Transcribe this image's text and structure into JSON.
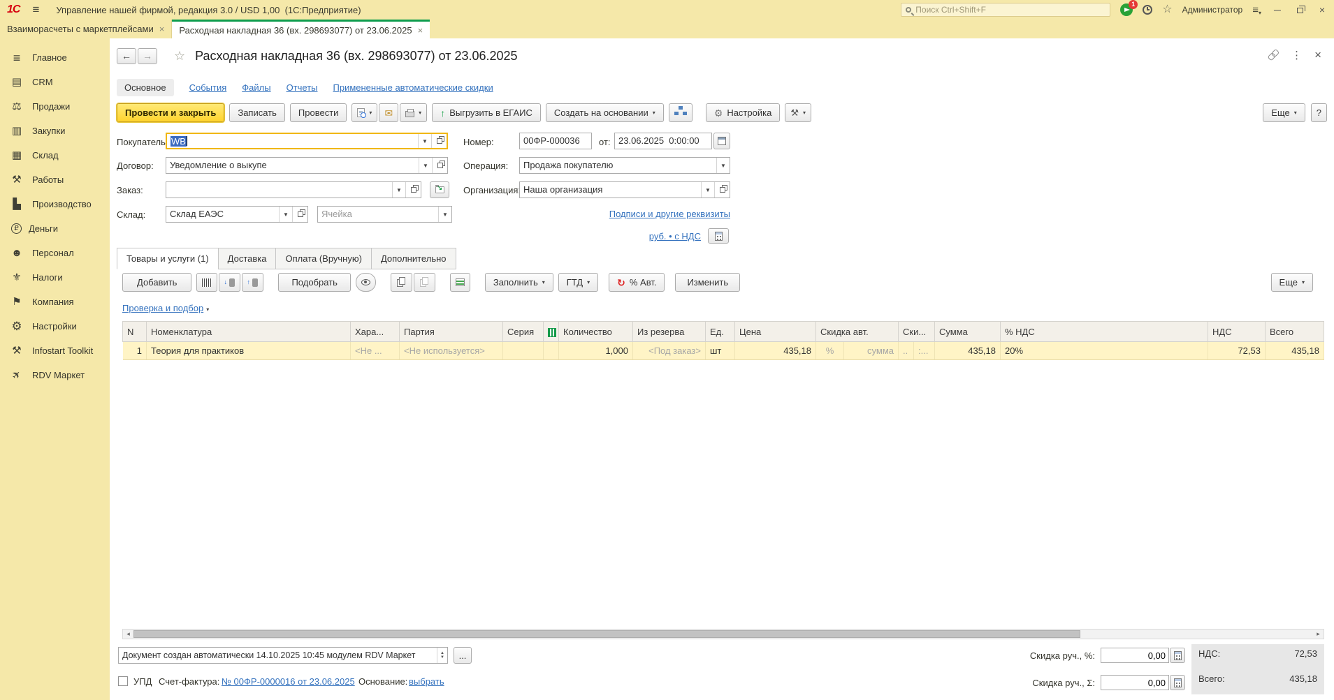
{
  "colors": {
    "chrome_yellow": "#F5E8A9",
    "active_tab_green": "#0E9D4E",
    "primary_button_yellow": "#FFD42E",
    "link_blue": "#3472BE",
    "selection_blue": "#3C6BC0",
    "row_highlight": "#FFF4C6"
  },
  "titlebar": {
    "logo": "1С",
    "title": "Управление нашей фирмой, редакция 3.0 / USD 1,00  (1С:Предприятие)",
    "search_placeholder": "Поиск Ctrl+Shift+F",
    "notification_count": "1",
    "user": "Администратор"
  },
  "tabstrip": {
    "tabs": [
      {
        "label": "Взаиморасчеты с маркетплейсами"
      },
      {
        "label": "Расходная накладная 36 (вх. 298693077) от 23.06.2025"
      }
    ]
  },
  "sidebar": {
    "items": [
      {
        "label": "Главное",
        "icon": "menu-icon"
      },
      {
        "label": "CRM",
        "icon": "crm-icon"
      },
      {
        "label": "Продажи",
        "icon": "sales-icon"
      },
      {
        "label": "Закупки",
        "icon": "purchases-icon"
      },
      {
        "label": "Склад",
        "icon": "warehouse-icon"
      },
      {
        "label": "Работы",
        "icon": "works-icon"
      },
      {
        "label": "Производство",
        "icon": "production-icon"
      },
      {
        "label": "Деньги",
        "icon": "money-icon"
      },
      {
        "label": "Персонал",
        "icon": "staff-icon"
      },
      {
        "label": "Налоги",
        "icon": "taxes-icon"
      },
      {
        "label": "Компания",
        "icon": "company-icon"
      },
      {
        "label": "Настройки",
        "icon": "settings-icon"
      },
      {
        "label": "Infostart Toolkit",
        "icon": "toolkit-icon"
      },
      {
        "label": "RDV Маркет",
        "icon": "rocket-icon"
      }
    ]
  },
  "doc": {
    "title": "Расходная накладная 36 (вх. 298693077) от 23.06.2025",
    "nav": {
      "active": "Основное",
      "links": [
        "События",
        "Файлы",
        "Отчеты",
        "Примененные автоматические скидки"
      ]
    },
    "commands": {
      "post_close": "Провести и закрыть",
      "write": "Записать",
      "post": "Провести",
      "egais": "Выгрузить в ЕГАИС",
      "create_on_base": "Создать на основании",
      "setup": "Настройка",
      "more": "Еще",
      "help": "?"
    },
    "fields": {
      "buyer_label": "Покупатель:",
      "buyer": "WB",
      "contract_label": "Договор:",
      "contract": "Уведомление о выкупе",
      "order_label": "Заказ:",
      "order": "",
      "wh_label": "Склад:",
      "wh": "Склад ЕАЭС",
      "cell_ph": "Ячейка",
      "num_label": "Номер:",
      "num": "00ФР-000036",
      "date_label": "от:",
      "date": "23.06.2025  0:00:00",
      "op_label": "Операция:",
      "op": "Продажа покупателю",
      "org_label": "Организация:",
      "org": "Наша организация"
    },
    "links": {
      "signs": "Подписи и другие реквизиты",
      "currency": "руб. • с НДС"
    },
    "section_tabs": [
      "Товары и услуги (1)",
      "Доставка",
      "Оплата (Вручную)",
      "Дополнительно"
    ],
    "tbar": {
      "add": "Добавить",
      "pick": "Подобрать",
      "fill": "Заполнить",
      "gtd": "ГТД",
      "auto": "% Авт.",
      "edit": "Изменить",
      "more": "Еще"
    },
    "check_link": "Проверка и подбор",
    "table": {
      "cols": {
        "n": "N",
        "nom": "Номенклатура",
        "har": "Хара...",
        "part": "Партия",
        "ser": "Серия",
        "qty": "Количество",
        "res": "Из резерва",
        "unit": "Ед.",
        "price": "Цена",
        "dauto": "Скидка авт.",
        "dman": "Ски...",
        "sum": "Сумма",
        "vatp": "% НДС",
        "vat": "НДС",
        "total": "Всего"
      },
      "row": {
        "n": "1",
        "nom": "Теория для практиков",
        "har": "<Не ...",
        "part": "<Не используется>",
        "ser": "",
        "qty": "1,000",
        "res": "<Под заказ>",
        "unit": "шт",
        "price": "435,18",
        "da_pct": "%",
        "da_sum": "сумма",
        "dm_a": "..",
        "dm_b": ":...",
        "sum": "435,18",
        "vatp": "20%",
        "vat": "72,53",
        "total": "435,18"
      }
    },
    "footer": {
      "comment": "Документ создан автоматически 14.10.2025 10:45 модулем RDV Маркет",
      "dots": "...",
      "upd": "УПД",
      "invoice_label": "Счет-фактура:",
      "invoice_link": "№ 00ФР-0000016 от 23.06.2025",
      "basis_label": "Основание:",
      "basis_link": "выбрать",
      "disc_pct_label": "Скидка руч., %:",
      "disc_pct": "0,00",
      "disc_sum_label": "Скидка руч., Σ:",
      "disc_sum": "0,00",
      "vat_label": "НДС:",
      "vat": "72,53",
      "total_label": "Всего:",
      "total": "435,18"
    }
  }
}
